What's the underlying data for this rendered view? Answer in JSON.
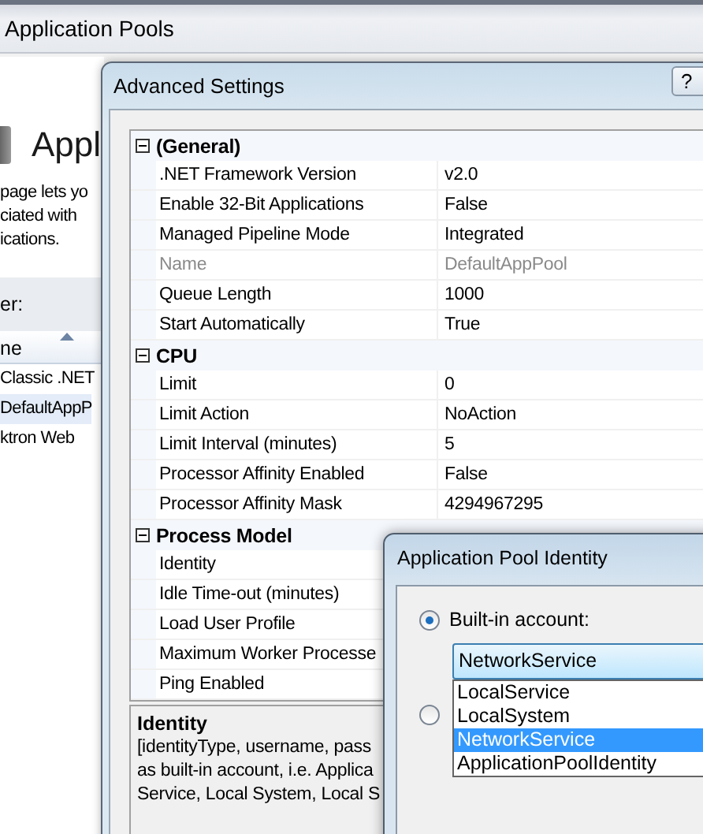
{
  "background_window": {
    "title": "Application Pools",
    "heading": "Appl",
    "description_lines": [
      "page lets yo",
      "ciated with",
      "ications."
    ],
    "filter_label": "er:",
    "column_header": "ne",
    "rows": [
      {
        "label": "Classic .NET",
        "selected": false
      },
      {
        "label": "DefaultAppP",
        "selected": true
      },
      {
        "label": "ktron Web",
        "selected": false
      }
    ]
  },
  "advanced_settings": {
    "title": "Advanced Settings",
    "help": "?",
    "categories": [
      {
        "name": "(General)",
        "expanded": true,
        "properties": [
          {
            "name": ".NET Framework Version",
            "value": "v2.0",
            "disabled": false
          },
          {
            "name": "Enable 32-Bit Applications",
            "value": "False",
            "disabled": false
          },
          {
            "name": "Managed Pipeline Mode",
            "value": "Integrated",
            "disabled": false
          },
          {
            "name": "Name",
            "value": "DefaultAppPool",
            "disabled": true
          },
          {
            "name": "Queue Length",
            "value": "1000",
            "disabled": false
          },
          {
            "name": "Start Automatically",
            "value": "True",
            "disabled": false
          }
        ]
      },
      {
        "name": "CPU",
        "expanded": true,
        "properties": [
          {
            "name": "Limit",
            "value": "0",
            "disabled": false
          },
          {
            "name": "Limit Action",
            "value": "NoAction",
            "disabled": false
          },
          {
            "name": "Limit Interval (minutes)",
            "value": "5",
            "disabled": false
          },
          {
            "name": "Processor Affinity Enabled",
            "value": "False",
            "disabled": false
          },
          {
            "name": "Processor Affinity Mask",
            "value": "4294967295",
            "disabled": false
          }
        ]
      },
      {
        "name": "Process Model",
        "expanded": true,
        "properties": [
          {
            "name": "Identity",
            "disabled": false
          },
          {
            "name": "Idle Time-out (minutes)",
            "disabled": false
          },
          {
            "name": "Load User Profile",
            "disabled": false
          },
          {
            "name": "Maximum Worker Processe",
            "disabled": false
          },
          {
            "name": "Ping Enabled",
            "disabled": false
          }
        ]
      }
    ],
    "description": {
      "title": "Identity",
      "lines": [
        "[identityType, username, pass",
        "as built-in account, i.e. Applica",
        "Service, Local System, Local S"
      ]
    }
  },
  "identity_dialog": {
    "title": "Application Pool Identity",
    "options": [
      {
        "label": "Built-in account:",
        "selected": true
      },
      {
        "selected": false
      }
    ],
    "combobox": {
      "value": "NetworkService"
    },
    "dropdown": [
      {
        "label": "LocalService",
        "selected": false
      },
      {
        "label": "LocalSystem",
        "selected": false
      },
      {
        "label": "NetworkService",
        "selected": true
      },
      {
        "label": "ApplicationPoolIdentity",
        "selected": false
      }
    ]
  }
}
